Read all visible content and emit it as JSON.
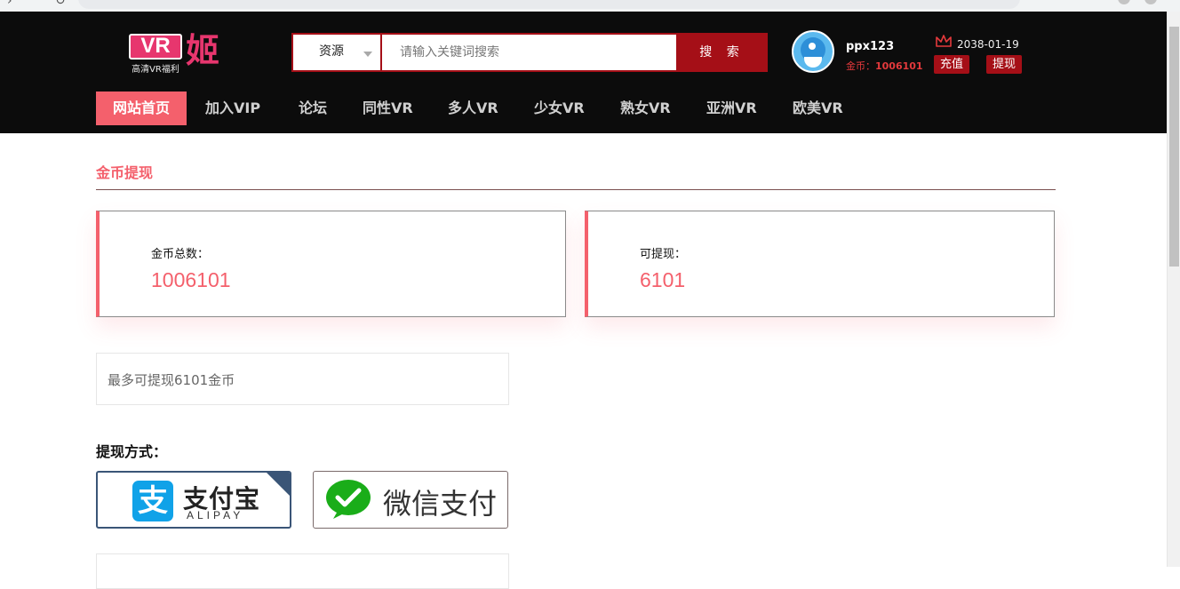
{
  "colors": {
    "header_bg": "#0c0c0c",
    "accent": "#f4606c",
    "brand_red": "#a50f17",
    "alipay_blue": "#10a2e8",
    "wechat_green": "#1aad19"
  },
  "header": {
    "logo": {
      "badge": "VR",
      "char": "姬",
      "tagline": "高清VR福利"
    },
    "search": {
      "category_selected": "资源",
      "placeholder": "请输入关键词搜索",
      "button_label": "搜 索"
    },
    "user": {
      "username": "ppx123",
      "coins_label": "金币：",
      "coins_value": "1006101",
      "expire_date": "2038-01-19",
      "recharge_label": "充值",
      "withdraw_label": "提现"
    },
    "nav": [
      {
        "label": "网站首页",
        "active": true
      },
      {
        "label": "加入VIP"
      },
      {
        "label": "论坛"
      },
      {
        "label": "同性VR"
      },
      {
        "label": "多人VR"
      },
      {
        "label": "少女VR"
      },
      {
        "label": "熟女VR"
      },
      {
        "label": "亚洲VR"
      },
      {
        "label": "欧美VR"
      }
    ]
  },
  "main": {
    "section_title": "金币提现",
    "stats": [
      {
        "label": "金币总数：",
        "value": "1006101"
      },
      {
        "label": "可提现：",
        "value": "6101"
      }
    ],
    "notice": "最多可提现6101金币",
    "method_label": "提现方式：",
    "methods": {
      "alipay": {
        "name": "支付宝",
        "name_en": "ALIPAY",
        "icon": "alipay-icon",
        "selected": true
      },
      "wechat": {
        "name": "微信支付",
        "icon": "wechat-pay-icon",
        "selected": false
      }
    }
  }
}
